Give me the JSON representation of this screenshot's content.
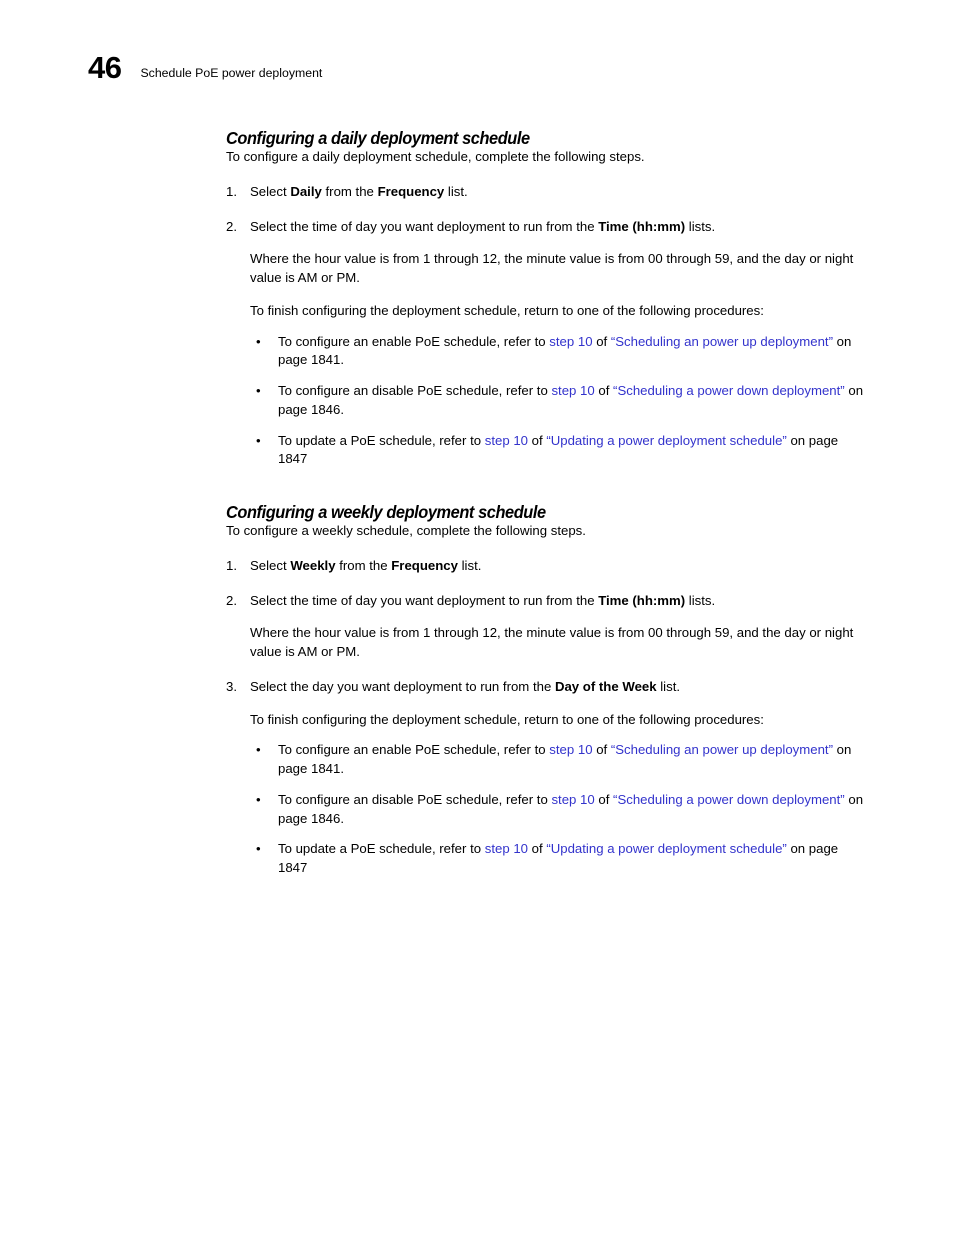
{
  "header": {
    "folio": "46",
    "title": "Schedule PoE power deployment"
  },
  "sections": [
    {
      "heading": "Configuring a daily deployment schedule",
      "intro": "To configure a daily deployment schedule, complete the following steps.",
      "steps": [
        {
          "num": "1.",
          "pre": "Select ",
          "bold1": "Daily",
          "mid": " from the ",
          "bold2": "Frequency",
          "post": " list."
        },
        {
          "num": "2.",
          "pre": "Select the time of day you want deployment to run from the ",
          "bold1": "Time (hh:mm)",
          "mid": "",
          "bold2": "",
          "post": " lists."
        }
      ],
      "sub_paras": [
        "Where the hour value is from 1 through 12, the minute value is from 00 through 59, and the day or night value is AM or PM.",
        "To finish configuring the deployment schedule, return to one of the following procedures:"
      ],
      "bullets": [
        {
          "pre": "To configure an enable PoE schedule, refer to ",
          "link_step": "step 10",
          "mid": " of ",
          "link_title": "“Scheduling an power up deployment”",
          "post": " on page 1841."
        },
        {
          "pre": "To configure an disable PoE schedule, refer to ",
          "link_step": "step 10",
          "mid": " of ",
          "link_title": "“Scheduling a power down deployment”",
          "post": " on page 1846."
        },
        {
          "pre": "To update a PoE schedule, refer to ",
          "link_step": "step 10",
          "mid": " of ",
          "link_title": "“Updating a power deployment schedule”",
          "post": " on page 1847"
        }
      ]
    },
    {
      "heading": "Configuring a weekly deployment schedule",
      "intro": "To configure a weekly schedule, complete the following steps.",
      "steps": [
        {
          "num": "1.",
          "pre": "Select ",
          "bold1": "Weekly",
          "mid": " from the ",
          "bold2": "Frequency",
          "post": " list."
        },
        {
          "num": "2.",
          "pre": "Select the time of day you want deployment to run from the ",
          "bold1": "Time (hh:mm)",
          "mid": "",
          "bold2": "",
          "post": " lists."
        },
        {
          "num": "3.",
          "pre": "Select the day you want deployment to run from the ",
          "bold1": "Day of the Week",
          "mid": "",
          "bold2": "",
          "post": " list."
        }
      ],
      "sub_para_after_step2": "Where the hour value is from 1 through 12, the minute value is from 00 through 59, and the day or night value is AM or PM.",
      "sub_para_after_step3": "To finish configuring the deployment schedule, return to one of the following procedures:",
      "bullets": [
        {
          "pre": "To configure an enable PoE schedule, refer to ",
          "link_step": "step 10",
          "mid": " of ",
          "link_title": "“Scheduling an power up deployment”",
          "post": " on page 1841."
        },
        {
          "pre": "To configure an disable PoE schedule, refer to ",
          "link_step": "step 10",
          "mid": " of ",
          "link_title": "“Scheduling a power down deployment”",
          "post": " on page 1846."
        },
        {
          "pre": "To update a PoE schedule, refer to ",
          "link_step": "step 10",
          "mid": " of ",
          "link_title": "“Updating a power deployment schedule”",
          "post": " on page 1847"
        }
      ]
    }
  ],
  "glyphs": {
    "bullet": "•"
  },
  "colors": {
    "link": "#3333CC",
    "text": "#000000",
    "background": "#FFFFFF"
  }
}
